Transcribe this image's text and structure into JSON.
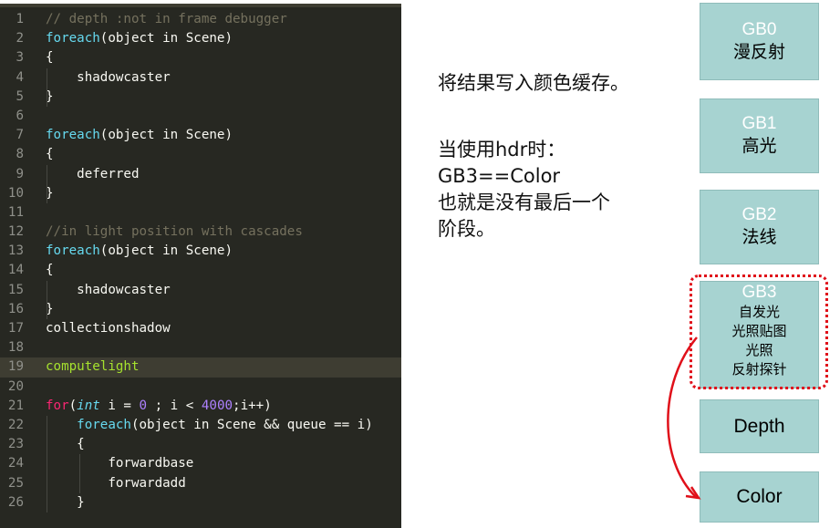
{
  "code": {
    "lines": [
      {
        "n": "1",
        "tokens": [
          [
            "cm",
            "// depth :not in frame debugger"
          ]
        ]
      },
      {
        "n": "2",
        "tokens": [
          [
            "fn",
            "foreach"
          ],
          [
            "pl",
            "(object in Scene)"
          ]
        ]
      },
      {
        "n": "3",
        "tokens": [
          [
            "pl",
            "{"
          ]
        ]
      },
      {
        "n": "4",
        "tokens": [
          [
            "pl",
            "    shadowcaster"
          ]
        ]
      },
      {
        "n": "5",
        "tokens": [
          [
            "pl",
            "}"
          ]
        ]
      },
      {
        "n": "6",
        "tokens": []
      },
      {
        "n": "7",
        "tokens": [
          [
            "fn",
            "foreach"
          ],
          [
            "pl",
            "(object in Scene)"
          ]
        ]
      },
      {
        "n": "8",
        "tokens": [
          [
            "pl",
            "{"
          ]
        ]
      },
      {
        "n": "9",
        "tokens": [
          [
            "pl",
            "    deferred"
          ]
        ]
      },
      {
        "n": "10",
        "tokens": [
          [
            "pl",
            "}"
          ]
        ]
      },
      {
        "n": "11",
        "tokens": []
      },
      {
        "n": "12",
        "tokens": [
          [
            "cm",
            "//in light position with cascades"
          ]
        ]
      },
      {
        "n": "13",
        "tokens": [
          [
            "fn",
            "foreach"
          ],
          [
            "pl",
            "(object in Scene)"
          ]
        ]
      },
      {
        "n": "14",
        "tokens": [
          [
            "pl",
            "{"
          ]
        ]
      },
      {
        "n": "15",
        "tokens": [
          [
            "pl",
            "    shadowcaster"
          ]
        ]
      },
      {
        "n": "16",
        "tokens": [
          [
            "pl",
            "}"
          ]
        ]
      },
      {
        "n": "17",
        "tokens": [
          [
            "pl",
            "collectionshadow"
          ]
        ]
      },
      {
        "n": "18",
        "tokens": []
      },
      {
        "n": "19",
        "tokens": [
          [
            "lt",
            "computelight"
          ]
        ],
        "highlight": true
      },
      {
        "n": "20",
        "tokens": []
      },
      {
        "n": "21",
        "tokens": [
          [
            "kw",
            "for"
          ],
          [
            "pl",
            "("
          ],
          [
            "ty",
            "int"
          ],
          [
            "pl",
            " i = "
          ],
          [
            "nu",
            "0"
          ],
          [
            "pl",
            " ; i < "
          ],
          [
            "nu",
            "4000"
          ],
          [
            "pl",
            ";i++)"
          ]
        ]
      },
      {
        "n": "22",
        "tokens": [
          [
            "pl",
            "    "
          ],
          [
            "fn",
            "foreach"
          ],
          [
            "pl",
            "(object in Scene && queue == i)"
          ]
        ]
      },
      {
        "n": "23",
        "tokens": [
          [
            "pl",
            "    {"
          ]
        ]
      },
      {
        "n": "24",
        "tokens": [
          [
            "pl",
            "        forwardbase"
          ]
        ]
      },
      {
        "n": "25",
        "tokens": [
          [
            "pl",
            "        forwardadd"
          ]
        ]
      },
      {
        "n": "26",
        "tokens": [
          [
            "pl",
            "    }"
          ]
        ]
      }
    ]
  },
  "notes": {
    "line1": "将结果写入颜色缓存。",
    "line2": "当使用hdr时：",
    "line3": "GB3==Color",
    "line4": "也就是没有最后一个",
    "line5": "阶段。"
  },
  "gbuffer": {
    "gb0": {
      "title": "GB0",
      "desc": "漫反射"
    },
    "gb1": {
      "title": "GB1",
      "desc": "高光"
    },
    "gb2": {
      "title": "GB2",
      "desc": "法线"
    },
    "gb3": {
      "title": "GB3",
      "items": [
        "自发光",
        "光照贴图",
        "光照",
        "反射探针"
      ]
    },
    "depth": {
      "label": "Depth"
    },
    "color": {
      "label": "Color"
    }
  },
  "colors": {
    "editor_bg": "#272822",
    "box_fill": "#a7d3d1",
    "highlight_red": "#e0101a"
  }
}
